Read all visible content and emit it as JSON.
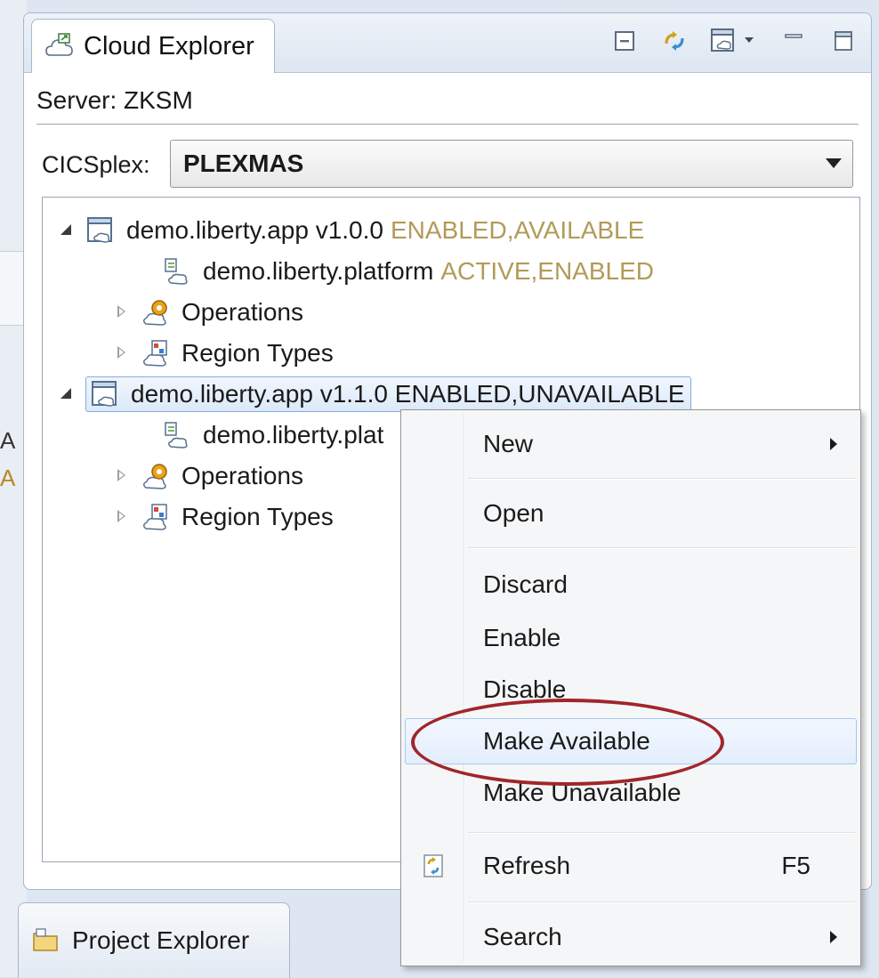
{
  "background_left": {
    "chars": [
      "A",
      "A"
    ]
  },
  "view": {
    "tab_title": "Cloud Explorer",
    "toolbar_icons": [
      "collapse-all-icon",
      "link-with-editor-icon",
      "view-menu-icon",
      "minimize-icon",
      "maximize-icon"
    ],
    "server_line": "Server: ZKSM",
    "cicsplex_label": "CICSplex:",
    "cicsplex_value": "PLEXMAS"
  },
  "tree": {
    "app1": {
      "name": "demo.liberty.app v1.0.0",
      "status": "ENABLED,AVAILABLE"
    },
    "app1_platform": {
      "name": "demo.liberty.platform",
      "status": "ACTIVE,ENABLED"
    },
    "app1_operations": "Operations",
    "app1_region_types": "Region Types",
    "app2": {
      "name": "demo.liberty.app v1.1.0 ENABLED,UNAVAILABLE"
    },
    "app2_platform": {
      "name": "demo.liberty.plat"
    },
    "app2_operations": "Operations",
    "app2_region_types": "Region Types"
  },
  "bottom_tab": {
    "label": "Project Explorer"
  },
  "context_menu": {
    "new": "New",
    "open": "Open",
    "discard": "Discard",
    "enable": "Enable",
    "disable": "Disable",
    "make_available": "Make Available",
    "make_unavailable": "Make Unavailable",
    "refresh": "Refresh",
    "refresh_accel": "F5",
    "search": "Search"
  },
  "colors": {
    "status_text": "#b19b58",
    "highlight_ring": "#a0262a",
    "selection_border": "#84acdd"
  }
}
